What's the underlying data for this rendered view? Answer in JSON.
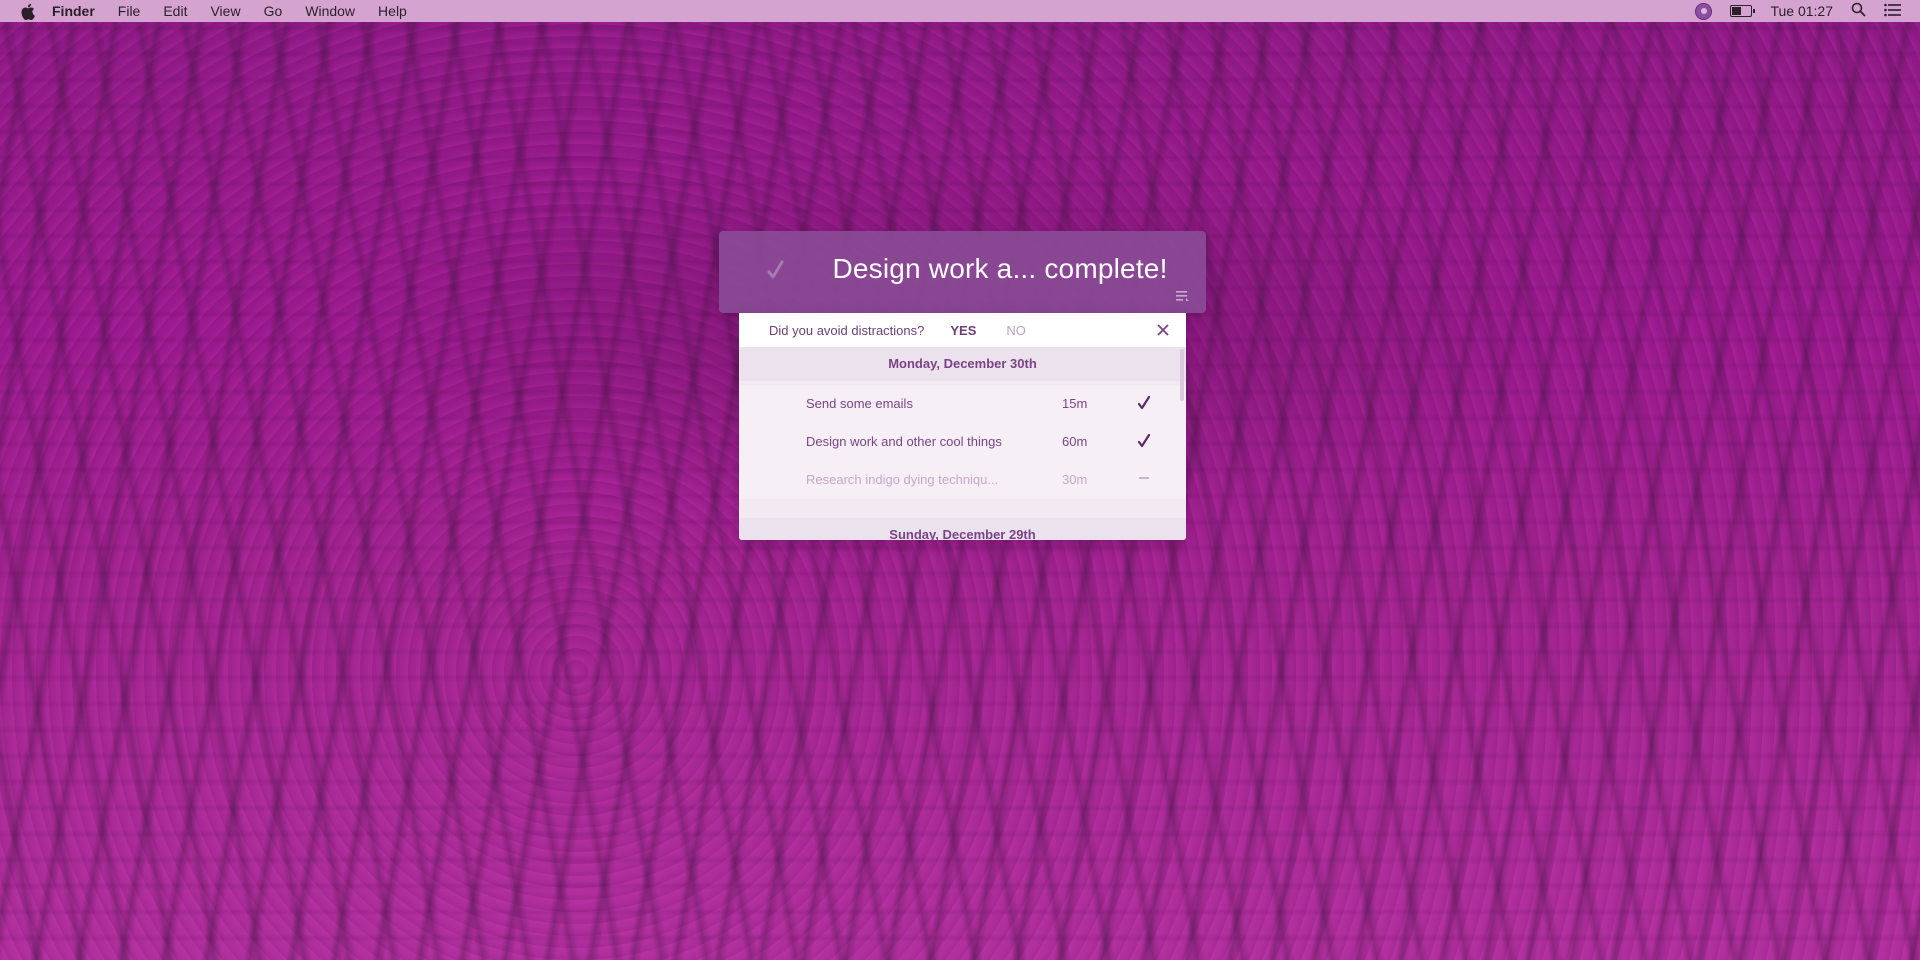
{
  "menubar": {
    "app_name": "Finder",
    "items": [
      "File",
      "Edit",
      "View",
      "Go",
      "Window",
      "Help"
    ],
    "clock": "Tue 01:27"
  },
  "notification": {
    "title": "Design work a... complete!"
  },
  "panel": {
    "question": "Did you avoid distractions?",
    "yes_label": "YES",
    "no_label": "NO",
    "days": [
      {
        "label": "Monday, December 30th",
        "tasks": [
          {
            "name": "Send some emails",
            "duration": "15m",
            "status": "done"
          },
          {
            "name": "Design work and other cool things",
            "duration": "60m",
            "status": "done"
          },
          {
            "name": "Research indigo dying techniqu...",
            "duration": "30m",
            "status": "skipped"
          }
        ]
      },
      {
        "label": "Sunday, December 29th",
        "tasks": []
      }
    ]
  },
  "colors": {
    "menubar_bg": "#d4a3cf",
    "notification_bg": "#8a4a96",
    "accent_text": "#7a4386",
    "dim_text": "#c2a9c7"
  }
}
